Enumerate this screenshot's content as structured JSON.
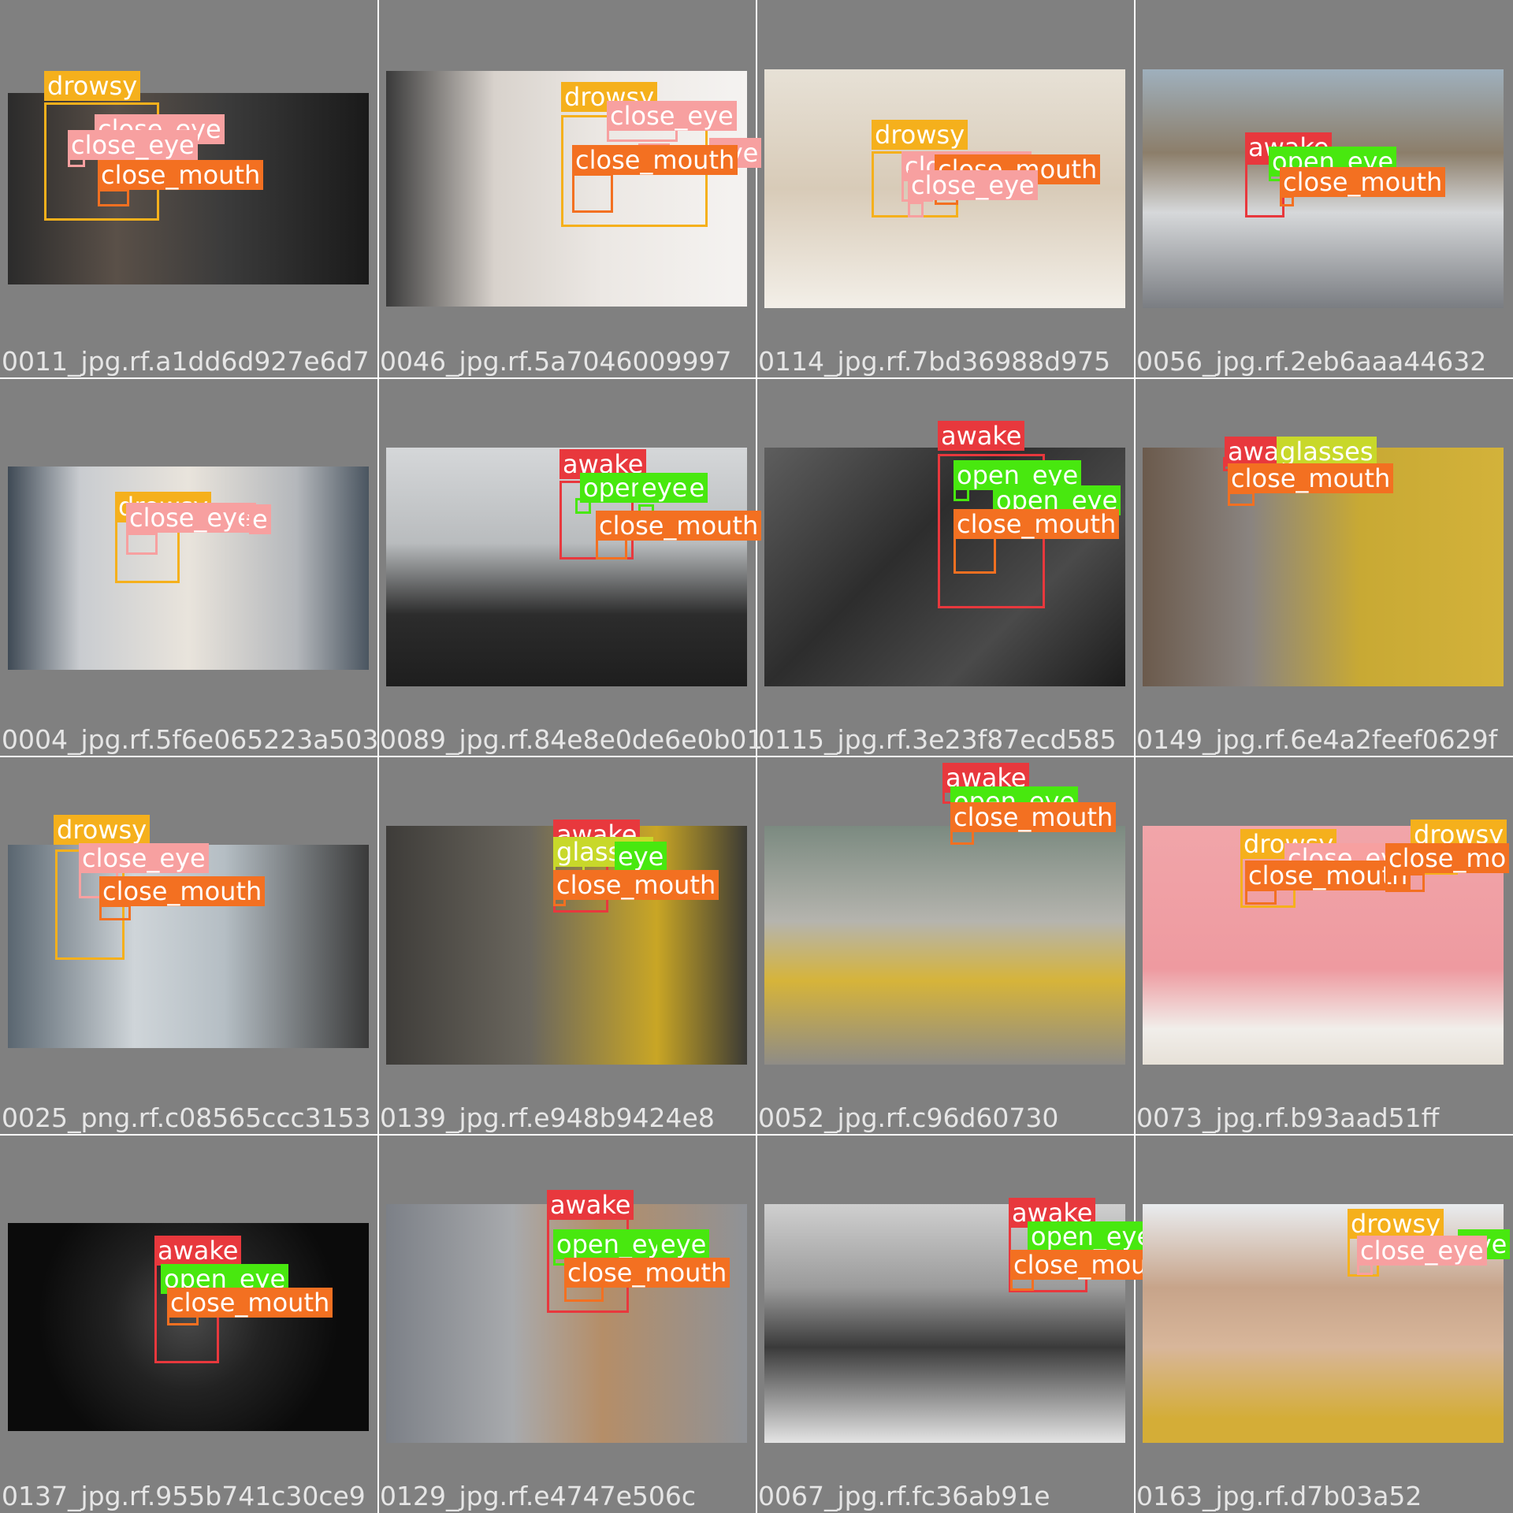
{
  "colors": {
    "drowsy": "#f5b01c",
    "awake": "#e8383d",
    "close_eye": "#f7a0a0",
    "close_mouth": "#f37021",
    "open_eye": "#48e80f",
    "glasses": "#c8d82a"
  },
  "tiles": [
    {
      "filename": "0011_jpg.rf.a1dd6d927e6d7",
      "labels": [
        {
          "cls": "drowsy",
          "text": "drowsy"
        },
        {
          "cls": "close_eye",
          "text": "close_eye"
        },
        {
          "cls": "close_eye",
          "text": "close_eye"
        },
        {
          "cls": "close_mouth",
          "text": "close_mouth"
        }
      ]
    },
    {
      "filename": "0046_jpg.rf.5a7046009997",
      "labels": [
        {
          "cls": "drowsy",
          "text": "drowsy"
        },
        {
          "cls": "close_eye",
          "text": "close_eye"
        },
        {
          "cls": "close_eye",
          "text": "eye"
        },
        {
          "cls": "close_mouth",
          "text": "close_mouth"
        }
      ]
    },
    {
      "filename": "0114_jpg.rf.7bd36988d975",
      "labels": [
        {
          "cls": "drowsy",
          "text": "drowsy"
        },
        {
          "cls": "close_eye",
          "text": "close_eye"
        },
        {
          "cls": "close_mouth",
          "text": "close_mouth"
        },
        {
          "cls": "close_eye",
          "text": "close_eye"
        }
      ]
    },
    {
      "filename": "0056_jpg.rf.2eb6aaa44632",
      "labels": [
        {
          "cls": "awake",
          "text": "awake"
        },
        {
          "cls": "open_eye",
          "text": "open_eye"
        },
        {
          "cls": "close_mouth",
          "text": "close_mouth"
        }
      ]
    },
    {
      "filename": "0004_jpg.rf.5f6e065223a503",
      "labels": [
        {
          "cls": "drowsy",
          "text": "drowsy"
        },
        {
          "cls": "close_eye",
          "text": "close_eye"
        },
        {
          "cls": "close_eye",
          "text": "e"
        }
      ]
    },
    {
      "filename": "0089_jpg.rf.84e8e0de6e0b01",
      "labels": [
        {
          "cls": "awake",
          "text": "awake"
        },
        {
          "cls": "open_eye",
          "text": "open_eye"
        },
        {
          "cls": "open_eye",
          "text": "eye"
        },
        {
          "cls": "close_mouth",
          "text": "close_mouth"
        }
      ]
    },
    {
      "filename": "0115_jpg.rf.3e23f87ecd585",
      "labels": [
        {
          "cls": "awake",
          "text": "awake"
        },
        {
          "cls": "open_eye",
          "text": "open_eye"
        },
        {
          "cls": "open_eye",
          "text": "open_eye"
        },
        {
          "cls": "close_mouth",
          "text": "close_mouth"
        }
      ]
    },
    {
      "filename": "0149_jpg.rf.6e4a2feef0629f",
      "labels": [
        {
          "cls": "awake",
          "text": "awake"
        },
        {
          "cls": "glasses",
          "text": "glasses"
        },
        {
          "cls": "close_mouth",
          "text": "close_mouth"
        }
      ]
    },
    {
      "filename": "0025_png.rf.c08565ccc3153",
      "labels": [
        {
          "cls": "drowsy",
          "text": "drowsy"
        },
        {
          "cls": "close_eye",
          "text": "close_eye"
        },
        {
          "cls": "close_mouth",
          "text": "close_mouth"
        }
      ]
    },
    {
      "filename": "0139_jpg.rf.e948b9424e8",
      "labels": [
        {
          "cls": "awake",
          "text": "awake"
        },
        {
          "cls": "glasses",
          "text": "glasses"
        },
        {
          "cls": "open_eye",
          "text": "eye"
        },
        {
          "cls": "close_mouth",
          "text": "close_mouth"
        }
      ]
    },
    {
      "filename": "0052_jpg.rf.c96d60730",
      "labels": [
        {
          "cls": "awake",
          "text": "awake"
        },
        {
          "cls": "open_eye",
          "text": "open_eye"
        },
        {
          "cls": "close_mouth",
          "text": "close_mouth"
        }
      ]
    },
    {
      "filename": "0073_jpg.rf.b93aad51ff",
      "labels": [
        {
          "cls": "drowsy",
          "text": "drowsy"
        },
        {
          "cls": "drowsy",
          "text": "drowsy"
        },
        {
          "cls": "close_eye",
          "text": "close_eye"
        },
        {
          "cls": "close_mouth",
          "text": "close_mouth"
        },
        {
          "cls": "close_mouth",
          "text": "close_mo"
        }
      ]
    },
    {
      "filename": "0137_jpg.rf.955b741c30ce9",
      "labels": [
        {
          "cls": "awake",
          "text": "awake"
        },
        {
          "cls": "open_eye",
          "text": "open_eye"
        },
        {
          "cls": "close_mouth",
          "text": "close_mouth"
        }
      ]
    },
    {
      "filename": "0129_jpg.rf.e4747e506c",
      "labels": [
        {
          "cls": "awake",
          "text": "awake"
        },
        {
          "cls": "open_eye",
          "text": "open_eye"
        },
        {
          "cls": "open_eye",
          "text": "eye"
        },
        {
          "cls": "close_mouth",
          "text": "close_mouth"
        }
      ]
    },
    {
      "filename": "0067_jpg.rf.fc36ab91e",
      "labels": [
        {
          "cls": "awake",
          "text": "awake"
        },
        {
          "cls": "open_eye",
          "text": "open_eye"
        },
        {
          "cls": "close_mouth",
          "text": "close_mouth"
        }
      ]
    },
    {
      "filename": "0163_jpg.rf.d7b03a52",
      "labels": [
        {
          "cls": "drowsy",
          "text": "drowsy"
        },
        {
          "cls": "open_eye",
          "text": "eye"
        },
        {
          "cls": "close_eye",
          "text": "close_eye"
        }
      ]
    }
  ]
}
